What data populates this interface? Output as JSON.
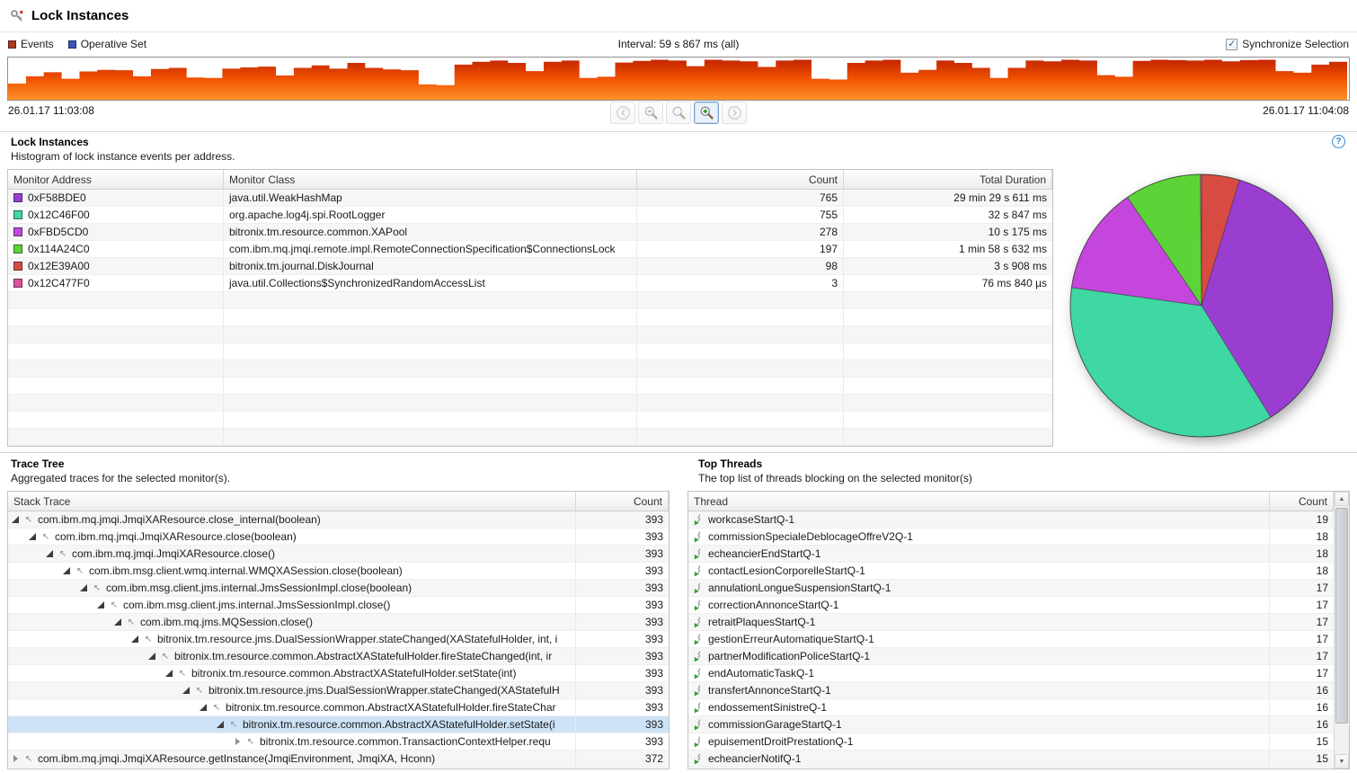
{
  "window": {
    "title": "Lock Instances"
  },
  "icons": {
    "scroll_up": "▲",
    "scroll_down": "▼",
    "frame_glyph": "↖",
    "check_glyph": "✓",
    "help_glyph": "?"
  },
  "timeline": {
    "legend": [
      {
        "label": "Events",
        "color": "#a93a22"
      },
      {
        "label": "Operative Set",
        "color": "#3a55b4"
      }
    ],
    "interval_label": "Interval: 59 s 867 ms (all)",
    "sync_label": "Synchronize Selection",
    "sync_checked": true,
    "start_time": "26.01.17 11:03:08",
    "end_time": "26.01.17 11:04:08"
  },
  "lock_instances": {
    "title": "Lock Instances",
    "subtitle": "Histogram of lock instance events per address.",
    "columns": [
      "Monitor Address",
      "Monitor Class",
      "Count",
      "Total Duration"
    ],
    "rows": [
      {
        "color": "#9a3ed2",
        "address": "0xF58BDE0",
        "class": "java.util.WeakHashMap",
        "count": "765",
        "duration": "29 min 29 s 611 ms"
      },
      {
        "color": "#3fd7a2",
        "address": "0x12C46F00",
        "class": "org.apache.log4j.spi.RootLogger",
        "count": "755",
        "duration": "32 s 847 ms"
      },
      {
        "color": "#c446dc",
        "address": "0xFBD5CD0",
        "class": "bitronix.tm.resource.common.XAPool",
        "count": "278",
        "duration": "10 s 175 ms"
      },
      {
        "color": "#5cd437",
        "address": "0x114A24C0",
        "class": "com.ibm.mq.jmqi.remote.impl.RemoteConnectionSpecification$ConnectionsLock",
        "count": "197",
        "duration": "1 min 58 s 632 ms"
      },
      {
        "color": "#d84b43",
        "address": "0x12E39A00",
        "class": "bitronix.tm.journal.DiskJournal",
        "count": "98",
        "duration": "3 s 908 ms"
      },
      {
        "color": "#e050a0",
        "address": "0x12C477F0",
        "class": "java.util.Collections$SynchronizedRandomAccessList",
        "count": "3",
        "duration": "76 ms 840 µs"
      }
    ]
  },
  "trace_tree": {
    "title": "Trace Tree",
    "subtitle": "Aggregated traces for the selected monitor(s).",
    "columns": [
      "Stack Trace",
      "Count"
    ],
    "rows": [
      {
        "level": 0,
        "state": "expanded",
        "selected": false,
        "text": "com.ibm.mq.jmqi.JmqiXAResource.close_internal(boolean)",
        "count": "393"
      },
      {
        "level": 1,
        "state": "expanded",
        "selected": false,
        "text": "com.ibm.mq.jmqi.JmqiXAResource.close(boolean)",
        "count": "393"
      },
      {
        "level": 2,
        "state": "expanded",
        "selected": false,
        "text": "com.ibm.mq.jmqi.JmqiXAResource.close()",
        "count": "393"
      },
      {
        "level": 3,
        "state": "expanded",
        "selected": false,
        "text": "com.ibm.msg.client.wmq.internal.WMQXASession.close(boolean)",
        "count": "393"
      },
      {
        "level": 4,
        "state": "expanded",
        "selected": false,
        "text": "com.ibm.msg.client.jms.internal.JmsSessionImpl.close(boolean)",
        "count": "393"
      },
      {
        "level": 5,
        "state": "expanded",
        "selected": false,
        "text": "com.ibm.msg.client.jms.internal.JmsSessionImpl.close()",
        "count": "393"
      },
      {
        "level": 6,
        "state": "expanded",
        "selected": false,
        "text": "com.ibm.mq.jms.MQSession.close()",
        "count": "393"
      },
      {
        "level": 7,
        "state": "expanded",
        "selected": false,
        "text": "bitronix.tm.resource.jms.DualSessionWrapper.stateChanged(XAStatefulHolder, int, i",
        "count": "393"
      },
      {
        "level": 8,
        "state": "expanded",
        "selected": false,
        "text": "bitronix.tm.resource.common.AbstractXAStatefulHolder.fireStateChanged(int, ir",
        "count": "393"
      },
      {
        "level": 9,
        "state": "expanded",
        "selected": false,
        "text": "bitronix.tm.resource.common.AbstractXAStatefulHolder.setState(int)",
        "count": "393"
      },
      {
        "level": 10,
        "state": "expanded",
        "selected": false,
        "text": "bitronix.tm.resource.jms.DualSessionWrapper.stateChanged(XAStatefulH",
        "count": "393"
      },
      {
        "level": 11,
        "state": "expanded",
        "selected": false,
        "text": "bitronix.tm.resource.common.AbstractXAStatefulHolder.fireStateChar",
        "count": "393"
      },
      {
        "level": 12,
        "state": "expanded",
        "selected": true,
        "text": "bitronix.tm.resource.common.AbstractXAStatefulHolder.setState(i",
        "count": "393"
      },
      {
        "level": 13,
        "state": "collapsed",
        "selected": false,
        "text": "bitronix.tm.resource.common.TransactionContextHelper.requ",
        "count": "393"
      },
      {
        "level": 0,
        "state": "collapsed",
        "selected": false,
        "text": "com.ibm.mq.jmqi.JmqiXAResource.getInstance(JmqiEnvironment, JmqiXA, Hconn)",
        "count": "372"
      }
    ]
  },
  "top_threads": {
    "title": "Top Threads",
    "subtitle": "The top list of threads blocking on the selected monitor(s)",
    "columns": [
      "Thread",
      "Count"
    ],
    "rows": [
      {
        "name": "workcaseStartQ-1",
        "count": "19"
      },
      {
        "name": "commissionSpecialeDeblocageOffreV2Q-1",
        "count": "18"
      },
      {
        "name": "echeancierEndStartQ-1",
        "count": "18"
      },
      {
        "name": "contactLesionCorporelleStartQ-1",
        "count": "18"
      },
      {
        "name": "annulationLongueSuspensionStartQ-1",
        "count": "17"
      },
      {
        "name": "correctionAnnonceStartQ-1",
        "count": "17"
      },
      {
        "name": "retraitPlaquesStartQ-1",
        "count": "17"
      },
      {
        "name": "gestionErreurAutomatiqueStartQ-1",
        "count": "17"
      },
      {
        "name": "partnerModificationPoliceStartQ-1",
        "count": "17"
      },
      {
        "name": "endAutomaticTaskQ-1",
        "count": "17"
      },
      {
        "name": "transfertAnnonceStartQ-1",
        "count": "16"
      },
      {
        "name": "endossementSinistreQ-1",
        "count": "16"
      },
      {
        "name": "commissionGarageStartQ-1",
        "count": "16"
      },
      {
        "name": "epuisementDroitPrestationQ-1",
        "count": "15"
      },
      {
        "name": "echeancierNotifQ-1",
        "count": "15"
      }
    ]
  },
  "chart_data": [
    {
      "type": "area",
      "x_range": [
        "26.01.17 11:03:08",
        "26.01.17 11:04:08"
      ],
      "interval": "59 s 867 ms",
      "legend_position": "top-left",
      "series": [
        {
          "name": "Events",
          "relative_heights": [
            40,
            58,
            68,
            52,
            70,
            74,
            73,
            58,
            76,
            79,
            55,
            54,
            77,
            80,
            82,
            60,
            79,
            85,
            77,
            91,
            79,
            75,
            73,
            38,
            36,
            87,
            94,
            97,
            91,
            71,
            94,
            97,
            54,
            57,
            92,
            96,
            99,
            97,
            83,
            99,
            97,
            95,
            81,
            97,
            99,
            52,
            50,
            91,
            97,
            99,
            67,
            74,
            97,
            91,
            79,
            54,
            79,
            97,
            95,
            99,
            97,
            61,
            57,
            96,
            99,
            98,
            97,
            99,
            95,
            98,
            99,
            71,
            67,
            87,
            94
          ]
        }
      ]
    },
    {
      "type": "pie",
      "start_angle_deg": -90,
      "direction": "clockwise",
      "legend_position": "none",
      "slices": [
        {
          "label": "0x12E39A00",
          "value": 98,
          "color": "#d84b43"
        },
        {
          "label": "0xF58BDE0",
          "value": 765,
          "color": "#9a3ed2"
        },
        {
          "label": "0x12C46F00",
          "value": 755,
          "color": "#3fd7a2"
        },
        {
          "label": "0xFBD5CD0",
          "value": 278,
          "color": "#c446dc"
        },
        {
          "label": "0x114A24C0",
          "value": 197,
          "color": "#5cd437"
        },
        {
          "label": "0x12C477F0",
          "value": 3,
          "color": "#e050a0"
        }
      ]
    }
  ]
}
